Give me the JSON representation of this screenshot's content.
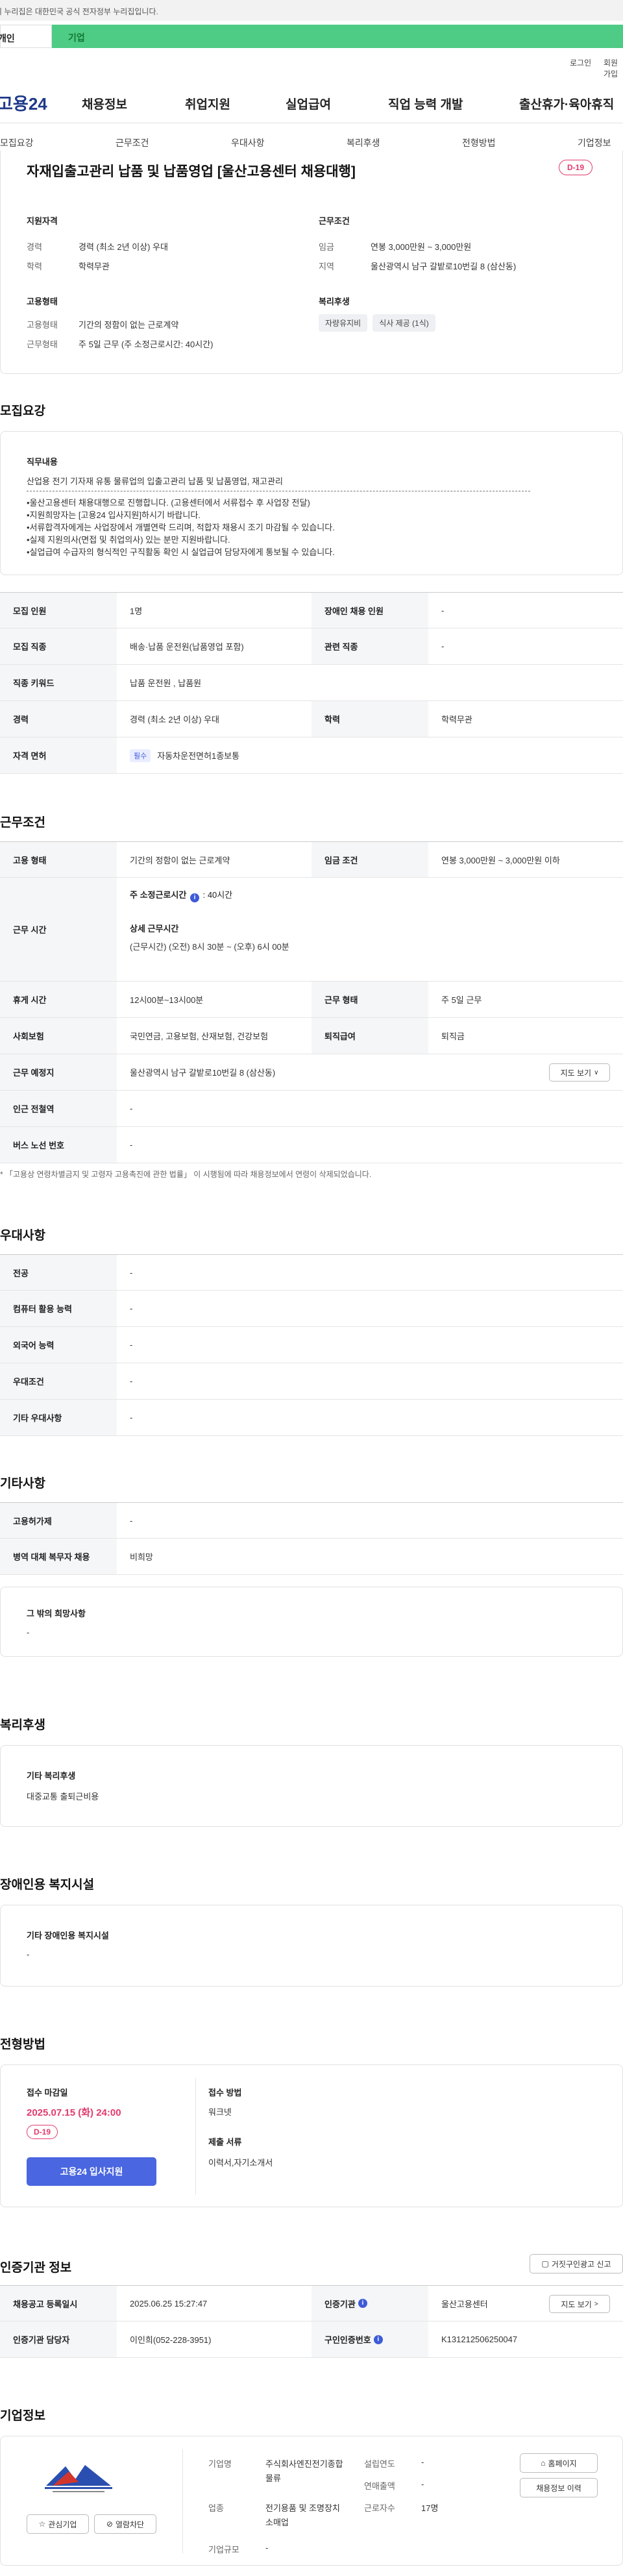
{
  "gov_banner": "이 누리집은 대한민국 공식 전자정부 누리집입니다.",
  "tabs": [
    "개인",
    "기업"
  ],
  "util": [
    "로그인",
    "회원가입"
  ],
  "logo": "고용24",
  "gnb": [
    "채용정보",
    "취업지원",
    "실업급여",
    "직업 능력 개발",
    "출산휴가·육아휴직"
  ],
  "snb": [
    "모집요강",
    "근무조건",
    "우대사항",
    "복리후생",
    "전형방법",
    "기업정보"
  ],
  "summary": {
    "title": "자재입출고관리 납품 및 납품영업 [울산고용센터 채용대행]",
    "dday": "D-19",
    "qual_title": "지원자격",
    "qual": [
      {
        "k": "경력",
        "v": "경력 (최소 2년 이상) 우대"
      },
      {
        "k": "학력",
        "v": "학력무관"
      }
    ],
    "cond_title": "근무조건",
    "cond": [
      {
        "k": "임금",
        "v": "연봉 3,000만원 ~ 3,000만원"
      },
      {
        "k": "지역",
        "v": "울산광역시 남구 갈밭로10번길 8 (삼산동)"
      }
    ],
    "emp_title": "고용형태",
    "emp": [
      {
        "k": "고용형태",
        "v": "기간의 정함이 없는 근로계약"
      },
      {
        "k": "근무형태",
        "v": "주 5일 근무 (주 소정근로시간: 40시간)"
      }
    ],
    "welfare_title": "복리후생",
    "welfare_chips": [
      "자량유지비",
      "식사 제공 (1식)"
    ]
  },
  "recruit": {
    "heading": "모집요강",
    "job_title": "직무내용",
    "job_desc": "산업용 전기 기자재 유통 물류업의 입출고관리 납품 및 납품영업, 재고관리",
    "notices": [
      "•울산고용센터 채용대행으로 진행합니다. (고용센터에서 서류접수 후 사업장 전달)",
      "•지원희망자는 [고용24 입사지원]하시기 바랍니다.",
      "•서류합격자에게는 사업장에서 개별연락 드리며, 적합자 채용시 조기 마감될 수 있습니다.",
      "•실제 지원의사(면접 및 취업의사) 있는 분만 지원바랍니다.",
      "•실업급여 수급자의 형식적인 구직활동 확인 시 실업급여 담당자에게 통보될 수 있습니다."
    ],
    "rows": [
      {
        "th1": "모집 인원",
        "td1": "1명",
        "th2": "장애인 채용 인원",
        "td2": "-"
      },
      {
        "th1": "모집 직종",
        "td1": "배송·납품 운전원(납품영업 포함)",
        "th2": "관련 직종",
        "td2": "-"
      },
      {
        "th1": "직종 키워드",
        "td1": "납품 운전원 , 납품원"
      },
      {
        "th1": "경력",
        "td1": "경력 (최소 2년 이상) 우대",
        "th2": "학력",
        "td2": "학력무관"
      },
      {
        "th1": "자격 면허",
        "tag": "필수",
        "td1": "자동차운전면허1종보통"
      }
    ]
  },
  "work": {
    "heading": "근무조건",
    "emp_th": "고용 형태",
    "emp_td": "기간의 정함이 없는 근로계약",
    "wage_th": "임금 조건",
    "wage_td": "연봉 3,000만원 ~ 3,000만원 이하",
    "hours_th": "근무 시간",
    "hours_main": "주 소정근로시간",
    "hours_main_val": ": 40시간",
    "hours_detail_title": "상세 근무시간",
    "hours_detail": "(근무시간) (오전) 8시 30분 ~ (오후) 6시 00분",
    "rest_th": "휴게 시간",
    "rest_td": "12시00분~13시00분",
    "form_th": "근무 형태",
    "form_td": "주 5일 근무",
    "ins_th": "사회보험",
    "ins_td": "국민연금, 고용보험, 산재보험, 건강보험",
    "sev_th": "퇴직급여",
    "sev_td": "퇴직금",
    "place_th": "근무 예정지",
    "place_td": "울산광역시 남구 갈밭로10번길 8 (삼산동)",
    "map_btn": "지도 보기",
    "subway_th": "인근 전철역",
    "subway_td": "-",
    "bus_th": "버스 노선 번호",
    "bus_td": "-",
    "footnote": "* 「고용상 연령차별금지 및 고령자 고용촉진에 관한 법률」 이 시행됨에 따라 채용정보에서 연령이 삭제되었습니다."
  },
  "pref": {
    "heading": "우대사항",
    "rows": [
      {
        "th": "전공",
        "td": "-"
      },
      {
        "th": "컴퓨터 활용 능력",
        "td": "-"
      },
      {
        "th": "외국어 능력",
        "td": "-"
      },
      {
        "th": "우대조건",
        "td": "-"
      },
      {
        "th": "기타 우대사항",
        "td": "-"
      }
    ]
  },
  "etc": {
    "heading": "기타사항",
    "rows": [
      {
        "th": "고용허가제",
        "td": "-"
      },
      {
        "th": "병역 대체 복무자 채용",
        "td": "비희망"
      }
    ],
    "box_title": "그 밖의 희망사항",
    "box_val": "-"
  },
  "benefit": {
    "heading": "복리후생",
    "box_title": "기타 복리후생",
    "box_val": "대중교통 출퇴근비용"
  },
  "disab": {
    "heading": "장애인용 복지시설",
    "box_title": "기타 장애인용 복지시설",
    "box_val": "-"
  },
  "process": {
    "heading": "전형방법",
    "deadline_title": "접수 마감일",
    "deadline": "2025.07.15 (화) 24:00",
    "dday": "D-19",
    "apply_btn": "고용24 입사지원",
    "method_title": "접수 방법",
    "method": "워크넷",
    "docs_title": "제출 서류",
    "docs": "이력서,자기소개서"
  },
  "cert": {
    "heading": "인증기관 정보",
    "report_btn": "거짓구인광고 신고",
    "rows": [
      {
        "th1": "채용공고 등록일시",
        "td1": "2025.06.25 15:27:47",
        "th2": "인증기관",
        "td2": "울산고용센터",
        "btn": "지도 보기"
      },
      {
        "th1": "인증기관 담당자",
        "td1": "이인희(052-228-3951)",
        "th2": "구인인증번호",
        "td2": "K131212506250047"
      }
    ]
  },
  "company": {
    "heading": "기업정보",
    "fav_btn": "관심기업",
    "block_btn": "열람차단",
    "fields": [
      {
        "k": "기업명",
        "v": "주식회사엔진전기종합물류"
      },
      {
        "k": "업종",
        "v": "전기용품 및 조명장치 소매업"
      },
      {
        "k": "기업규모",
        "v": "-"
      }
    ],
    "fields2": [
      {
        "k": "설립연도",
        "v": "-"
      },
      {
        "k": "연매출액",
        "v": "-"
      },
      {
        "k": "근로자수",
        "v": "17명"
      }
    ],
    "home_btn": "홈페이지",
    "jobs_btn": "채용정보 이력"
  }
}
